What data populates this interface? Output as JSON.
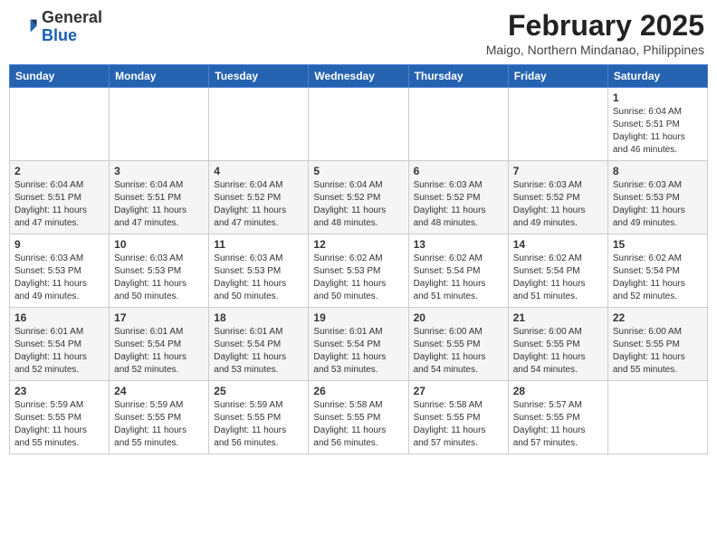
{
  "header": {
    "logo_general": "General",
    "logo_blue": "Blue",
    "month_title": "February 2025",
    "location": "Maigo, Northern Mindanao, Philippines"
  },
  "weekdays": [
    "Sunday",
    "Monday",
    "Tuesday",
    "Wednesday",
    "Thursday",
    "Friday",
    "Saturday"
  ],
  "weeks": [
    [
      {
        "day": "",
        "info": ""
      },
      {
        "day": "",
        "info": ""
      },
      {
        "day": "",
        "info": ""
      },
      {
        "day": "",
        "info": ""
      },
      {
        "day": "",
        "info": ""
      },
      {
        "day": "",
        "info": ""
      },
      {
        "day": "1",
        "info": "Sunrise: 6:04 AM\nSunset: 5:51 PM\nDaylight: 11 hours\nand 46 minutes."
      }
    ],
    [
      {
        "day": "2",
        "info": "Sunrise: 6:04 AM\nSunset: 5:51 PM\nDaylight: 11 hours\nand 47 minutes."
      },
      {
        "day": "3",
        "info": "Sunrise: 6:04 AM\nSunset: 5:51 PM\nDaylight: 11 hours\nand 47 minutes."
      },
      {
        "day": "4",
        "info": "Sunrise: 6:04 AM\nSunset: 5:52 PM\nDaylight: 11 hours\nand 47 minutes."
      },
      {
        "day": "5",
        "info": "Sunrise: 6:04 AM\nSunset: 5:52 PM\nDaylight: 11 hours\nand 48 minutes."
      },
      {
        "day": "6",
        "info": "Sunrise: 6:03 AM\nSunset: 5:52 PM\nDaylight: 11 hours\nand 48 minutes."
      },
      {
        "day": "7",
        "info": "Sunrise: 6:03 AM\nSunset: 5:52 PM\nDaylight: 11 hours\nand 49 minutes."
      },
      {
        "day": "8",
        "info": "Sunrise: 6:03 AM\nSunset: 5:53 PM\nDaylight: 11 hours\nand 49 minutes."
      }
    ],
    [
      {
        "day": "9",
        "info": "Sunrise: 6:03 AM\nSunset: 5:53 PM\nDaylight: 11 hours\nand 49 minutes."
      },
      {
        "day": "10",
        "info": "Sunrise: 6:03 AM\nSunset: 5:53 PM\nDaylight: 11 hours\nand 50 minutes."
      },
      {
        "day": "11",
        "info": "Sunrise: 6:03 AM\nSunset: 5:53 PM\nDaylight: 11 hours\nand 50 minutes."
      },
      {
        "day": "12",
        "info": "Sunrise: 6:02 AM\nSunset: 5:53 PM\nDaylight: 11 hours\nand 50 minutes."
      },
      {
        "day": "13",
        "info": "Sunrise: 6:02 AM\nSunset: 5:54 PM\nDaylight: 11 hours\nand 51 minutes."
      },
      {
        "day": "14",
        "info": "Sunrise: 6:02 AM\nSunset: 5:54 PM\nDaylight: 11 hours\nand 51 minutes."
      },
      {
        "day": "15",
        "info": "Sunrise: 6:02 AM\nSunset: 5:54 PM\nDaylight: 11 hours\nand 52 minutes."
      }
    ],
    [
      {
        "day": "16",
        "info": "Sunrise: 6:01 AM\nSunset: 5:54 PM\nDaylight: 11 hours\nand 52 minutes."
      },
      {
        "day": "17",
        "info": "Sunrise: 6:01 AM\nSunset: 5:54 PM\nDaylight: 11 hours\nand 52 minutes."
      },
      {
        "day": "18",
        "info": "Sunrise: 6:01 AM\nSunset: 5:54 PM\nDaylight: 11 hours\nand 53 minutes."
      },
      {
        "day": "19",
        "info": "Sunrise: 6:01 AM\nSunset: 5:54 PM\nDaylight: 11 hours\nand 53 minutes."
      },
      {
        "day": "20",
        "info": "Sunrise: 6:00 AM\nSunset: 5:55 PM\nDaylight: 11 hours\nand 54 minutes."
      },
      {
        "day": "21",
        "info": "Sunrise: 6:00 AM\nSunset: 5:55 PM\nDaylight: 11 hours\nand 54 minutes."
      },
      {
        "day": "22",
        "info": "Sunrise: 6:00 AM\nSunset: 5:55 PM\nDaylight: 11 hours\nand 55 minutes."
      }
    ],
    [
      {
        "day": "23",
        "info": "Sunrise: 5:59 AM\nSunset: 5:55 PM\nDaylight: 11 hours\nand 55 minutes."
      },
      {
        "day": "24",
        "info": "Sunrise: 5:59 AM\nSunset: 5:55 PM\nDaylight: 11 hours\nand 55 minutes."
      },
      {
        "day": "25",
        "info": "Sunrise: 5:59 AM\nSunset: 5:55 PM\nDaylight: 11 hours\nand 56 minutes."
      },
      {
        "day": "26",
        "info": "Sunrise: 5:58 AM\nSunset: 5:55 PM\nDaylight: 11 hours\nand 56 minutes."
      },
      {
        "day": "27",
        "info": "Sunrise: 5:58 AM\nSunset: 5:55 PM\nDaylight: 11 hours\nand 57 minutes."
      },
      {
        "day": "28",
        "info": "Sunrise: 5:57 AM\nSunset: 5:55 PM\nDaylight: 11 hours\nand 57 minutes."
      },
      {
        "day": "",
        "info": ""
      }
    ]
  ]
}
